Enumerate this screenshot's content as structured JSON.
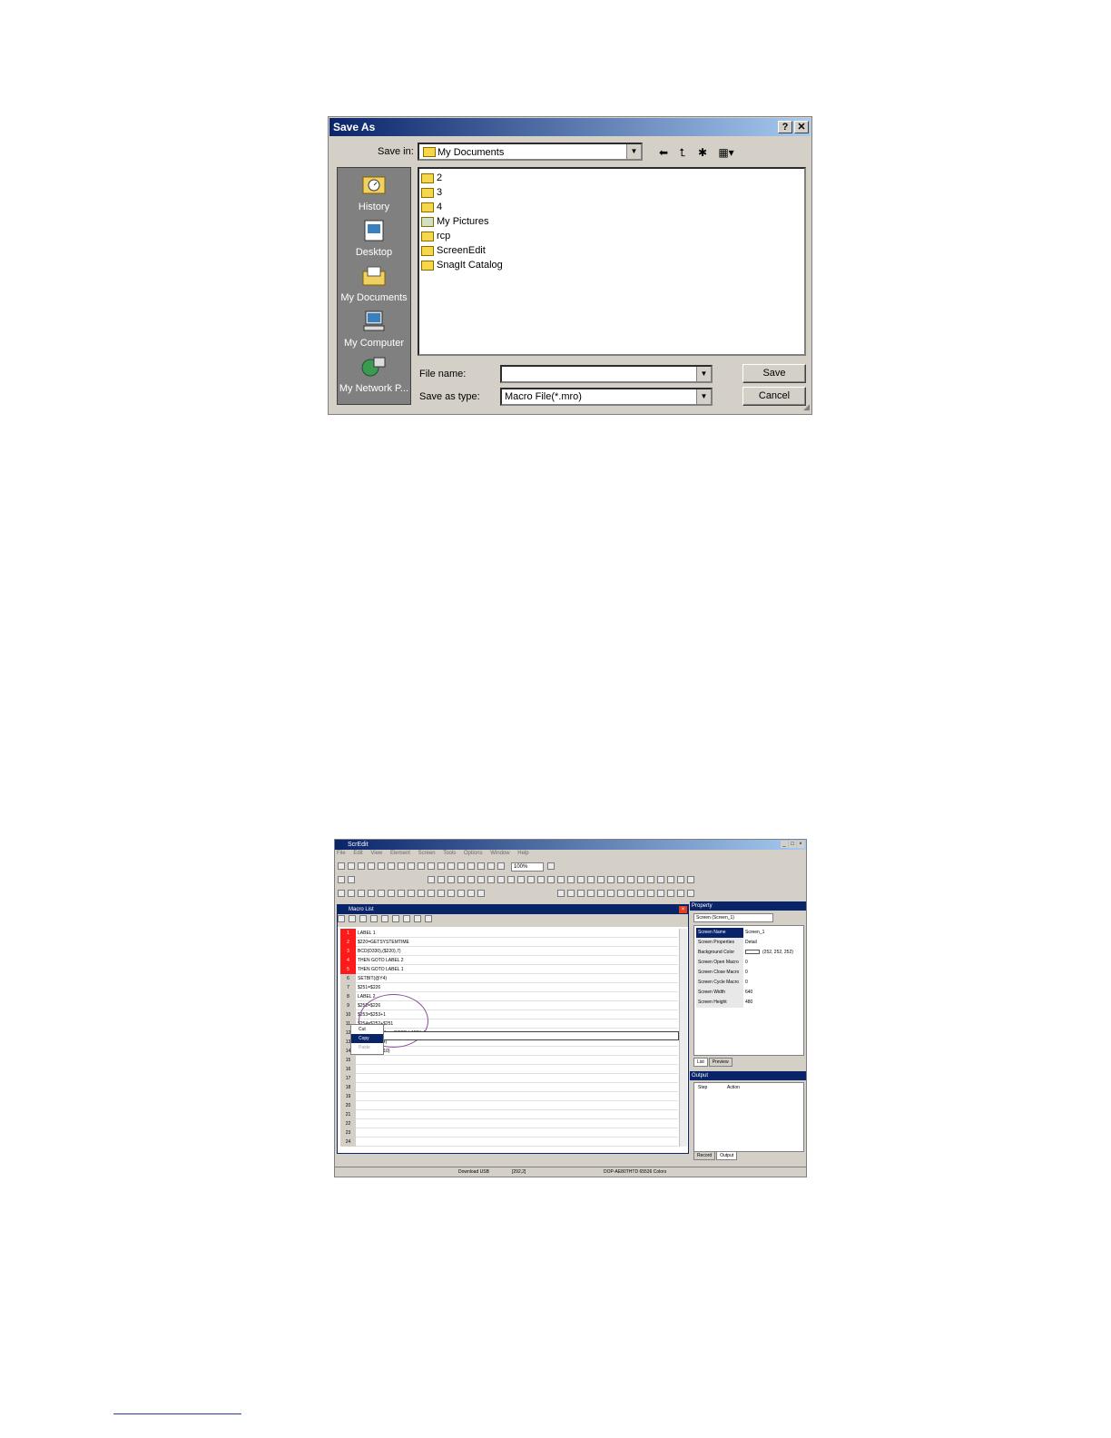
{
  "save_as": {
    "title": "Save As",
    "help_btn": "?",
    "close_btn": "✕",
    "save_in_label": "Save in:",
    "save_in_value": "My Documents",
    "places": [
      "History",
      "Desktop",
      "My Documents",
      "My Computer",
      "My Network P..."
    ],
    "files": [
      {
        "name": "2",
        "icon": "folder-icon"
      },
      {
        "name": "3",
        "icon": "folder-icon"
      },
      {
        "name": "4",
        "icon": "folder-icon"
      },
      {
        "name": "My Pictures",
        "icon": "pictures-folder-icon"
      },
      {
        "name": "rcp",
        "icon": "folder-icon"
      },
      {
        "name": "ScreenEdit",
        "icon": "folder-icon"
      },
      {
        "name": "SnagIt Catalog",
        "icon": "folder-icon"
      }
    ],
    "file_name_label": "File name:",
    "file_name_value": "",
    "save_type_label": "Save as type:",
    "save_type_value": "Macro File(*.mro)",
    "save_button": "Save",
    "cancel_button": "Cancel"
  },
  "scredit": {
    "title": "ScrEdit",
    "menu": [
      "File",
      "Edit",
      "View",
      "Element",
      "Screen",
      "Tools",
      "Options",
      "Window",
      "Help"
    ],
    "zoom": "100%",
    "macro_list": {
      "title": "Macro List",
      "rows": [
        {
          "n": "1",
          "code": "LABEL 1",
          "red": true
        },
        {
          "n": "2",
          "code": "$220=GETSYSTEMTIME",
          "red": true
        },
        {
          "n": "3",
          "code": "BCD(D330),($220),7)",
          "red": true
        },
        {
          "n": "4",
          "code": "THEN GOTO LABEL 2",
          "red": true
        },
        {
          "n": "5",
          "code": "THEN GOTO LABEL 1",
          "red": true
        },
        {
          "n": "6",
          "code": "SETBIT(@Y4)",
          "red": false
        },
        {
          "n": "7",
          "code": "$251=$226",
          "red": false
        },
        {
          "n": "8",
          "code": "LABEL 2",
          "red": false
        },
        {
          "n": "9",
          "code": "$252=$226",
          "red": false
        },
        {
          "n": "10",
          "code": "$253=$253+1",
          "red": false
        },
        {
          "n": "11",
          "code": "$254=$252+$251",
          "red": false
        },
        {
          "n": "12",
          "code": "IF $254<=4 Then GOTO LABEL 1",
          "red": false
        },
        {
          "n": "13",
          "code": "CLRBIT(@Y4)",
          "red": false
        },
        {
          "n": "14",
          "code": "FILL($250,0,10)",
          "red": false
        },
        {
          "n": "15",
          "code": "",
          "red": false
        },
        {
          "n": "16",
          "code": "",
          "red": false
        },
        {
          "n": "17",
          "code": "",
          "red": false
        },
        {
          "n": "18",
          "code": "",
          "red": false
        },
        {
          "n": "19",
          "code": "",
          "red": false
        },
        {
          "n": "20",
          "code": "",
          "red": false
        },
        {
          "n": "21",
          "code": "",
          "red": false
        },
        {
          "n": "22",
          "code": "",
          "red": false
        },
        {
          "n": "23",
          "code": "",
          "red": false
        },
        {
          "n": "24",
          "code": "",
          "red": false
        }
      ],
      "context_menu": [
        "Cut",
        "Copy",
        "Paste"
      ]
    },
    "property": {
      "title": "Property",
      "screen_select": "Screen (Screen_1)",
      "rows": [
        {
          "k": "Screen Name",
          "v": "Screen_1",
          "sel": true
        },
        {
          "k": "Screen Properties",
          "v": "Detail"
        },
        {
          "k": "Background Color",
          "v": "(252, 252, 252)",
          "swatch": true
        },
        {
          "k": "Screen Open Macro",
          "v": "0"
        },
        {
          "k": "Screen Close Macro",
          "v": "0"
        },
        {
          "k": "Screen Cycle Macro",
          "v": "0"
        },
        {
          "k": "Screen Width",
          "v": "640"
        },
        {
          "k": "Screen Height",
          "v": "480"
        }
      ],
      "tabs": [
        "List",
        "Preview"
      ]
    },
    "output": {
      "title": "Output",
      "col_step": "Step",
      "col_action": "Action",
      "tabs": [
        "Record",
        "Output"
      ]
    },
    "status": {
      "download": "Download USB",
      "coords": "[292,2]",
      "model": "DOP-AE80THTD 65536 Colors"
    }
  }
}
